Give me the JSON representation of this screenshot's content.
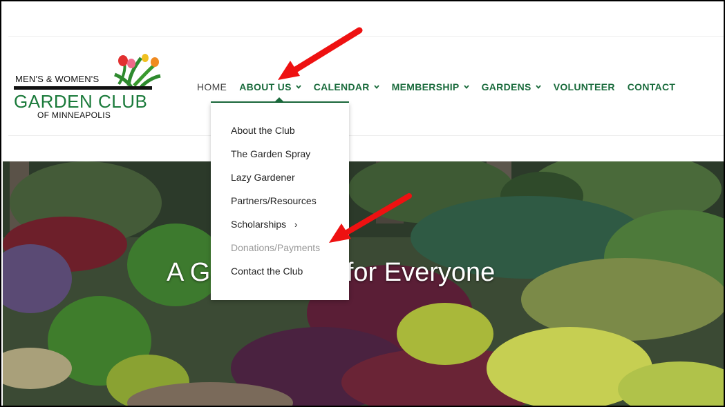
{
  "logo": {
    "line1": "MEN'S & WOMEN'S",
    "line2": "GARDEN CLUB",
    "line3": "OF MINNEAPOLIS"
  },
  "nav": {
    "home": "HOME",
    "about": "ABOUT US",
    "calendar": "CALENDAR",
    "membership": "MEMBERSHIP",
    "gardens": "GARDENS",
    "volunteer": "VOLUNTEER",
    "contact": "CONTACT"
  },
  "dropdown": {
    "items": [
      "About the Club",
      "The Garden Spray",
      "Lazy Gardener",
      "Partners/Resources",
      "Scholarships",
      "Donations/Payments",
      "Contact the Club"
    ]
  },
  "hero": {
    "title": "A Garden Club for Everyone"
  },
  "colors": {
    "brand_green": "#1a6b3c",
    "logo_green": "#1a7a3a",
    "muted_item": "#999999",
    "annotation_red": "#ee1111"
  }
}
